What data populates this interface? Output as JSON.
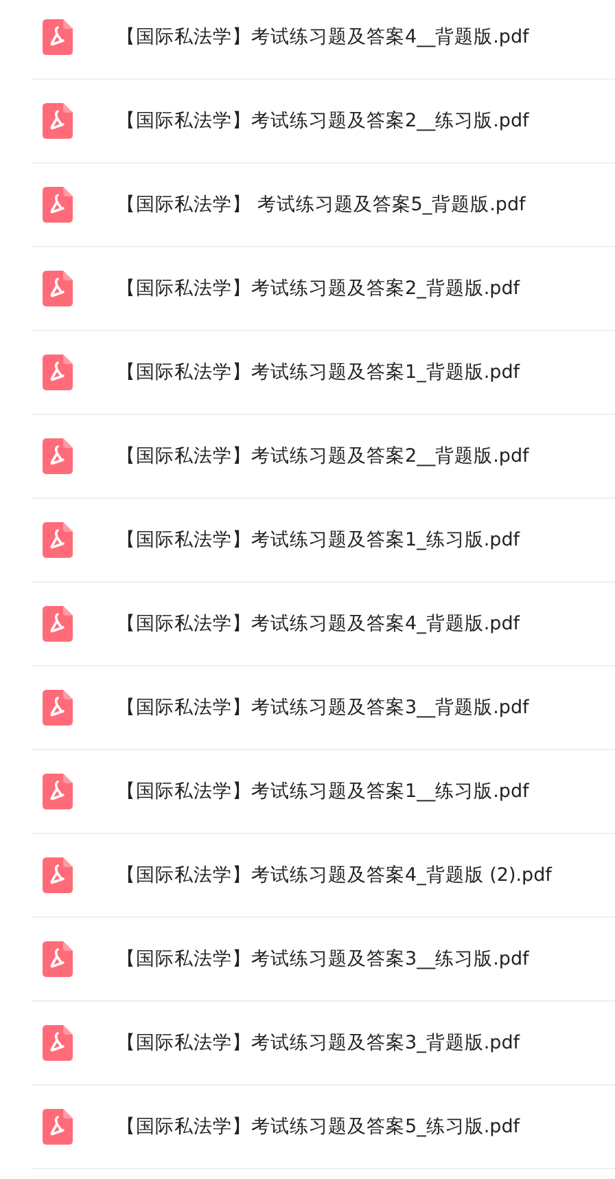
{
  "files": [
    {
      "name": "【国际私法学】考试练习题及答案4__背题版.pdf"
    },
    {
      "name": "【国际私法学】考试练习题及答案2__练习版.pdf"
    },
    {
      "name": "【国际私法学】 考试练习题及答案5_背题版.pdf"
    },
    {
      "name": "【国际私法学】考试练习题及答案2_背题版.pdf"
    },
    {
      "name": "【国际私法学】考试练习题及答案1_背题版.pdf"
    },
    {
      "name": "【国际私法学】考试练习题及答案2__背题版.pdf"
    },
    {
      "name": "【国际私法学】考试练习题及答案1_练习版.pdf"
    },
    {
      "name": "【国际私法学】考试练习题及答案4_背题版.pdf"
    },
    {
      "name": "【国际私法学】考试练习题及答案3__背题版.pdf"
    },
    {
      "name": "【国际私法学】考试练习题及答案1__练习版.pdf"
    },
    {
      "name": "【国际私法学】考试练习题及答案4_背题版 (2).pdf"
    },
    {
      "name": "【国际私法学】考试练习题及答案3__练习版.pdf"
    },
    {
      "name": "【国际私法学】考试练习题及答案3_背题版.pdf"
    },
    {
      "name": "【国际私法学】考试练习题及答案5_练习版.pdf"
    }
  ]
}
